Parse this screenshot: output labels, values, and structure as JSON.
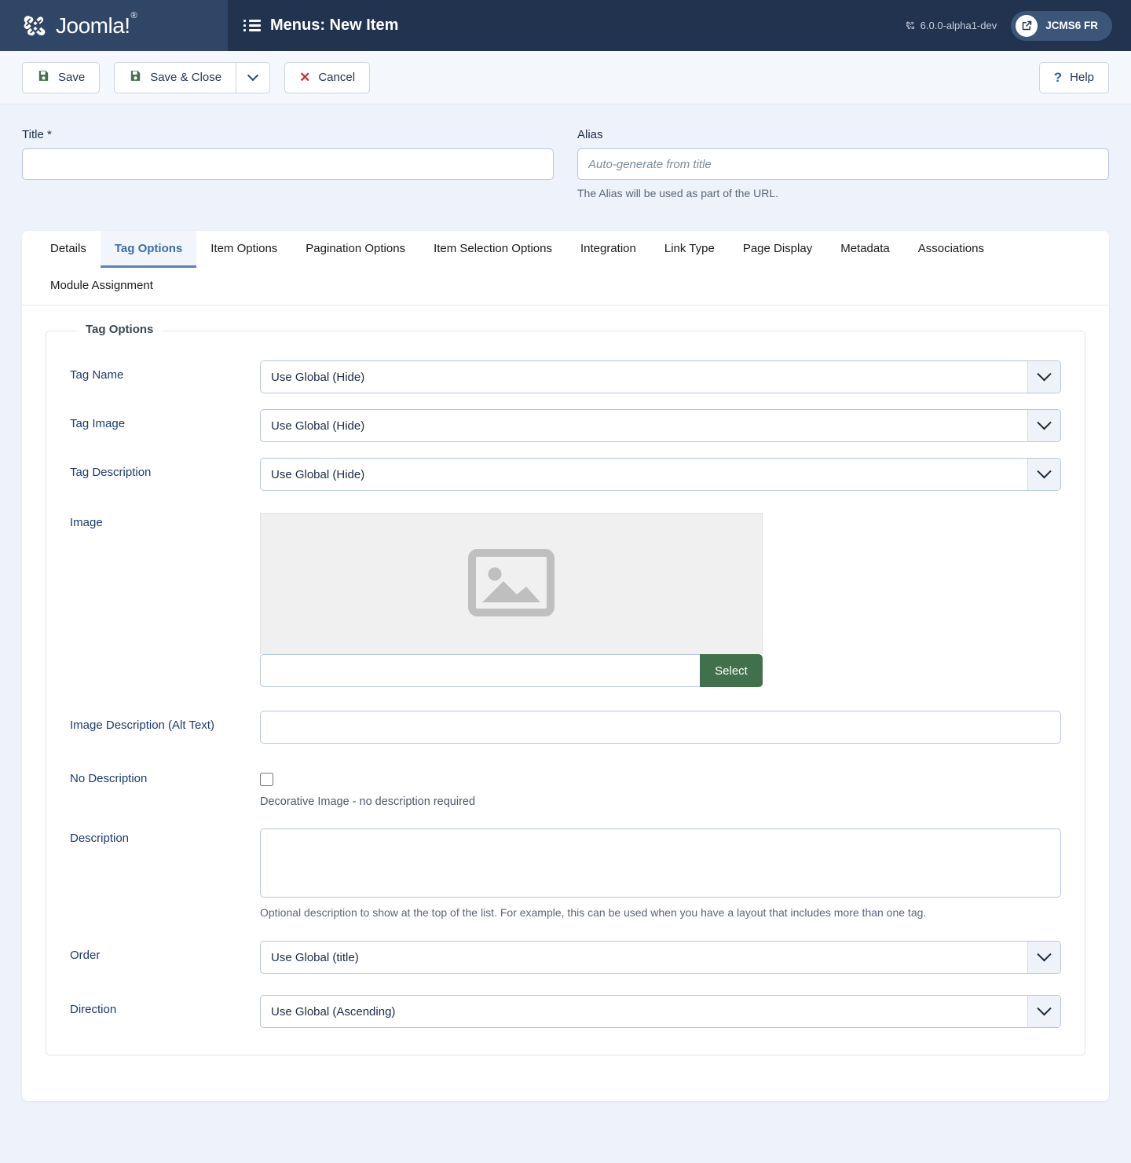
{
  "header": {
    "brand_name": "Joomla!",
    "brand_trademark": "®",
    "menu_icon": "list-icon",
    "page_title": "Menus: New Item",
    "version": "6.0.0-alpha1-dev",
    "version_icon": "joomla-mark-icon",
    "site_button_label": "JCMS6 FR",
    "site_button_icon": "external-link-icon"
  },
  "toolbar": {
    "save_label": "Save",
    "save_icon": "floppy-disk-icon",
    "save_close_label": "Save & Close",
    "save_close_icon": "floppy-disk-icon",
    "dropdown_icon": "chevron-down-icon",
    "cancel_label": "Cancel",
    "cancel_icon": "close-x-icon",
    "help_label": "Help",
    "help_icon": "question-mark-icon"
  },
  "form_top": {
    "title_label": "Title *",
    "title_value": "",
    "title_placeholder": "",
    "alias_label": "Alias",
    "alias_value": "",
    "alias_placeholder": "Auto-generate from title",
    "alias_helper": "The Alias will be used as part of the URL."
  },
  "tabs": [
    {
      "label": "Details",
      "active": false
    },
    {
      "label": "Tag Options",
      "active": true
    },
    {
      "label": "Item Options",
      "active": false
    },
    {
      "label": "Pagination Options",
      "active": false
    },
    {
      "label": "Item Selection Options",
      "active": false
    },
    {
      "label": "Integration",
      "active": false
    },
    {
      "label": "Link Type",
      "active": false
    },
    {
      "label": "Page Display",
      "active": false
    },
    {
      "label": "Metadata",
      "active": false
    },
    {
      "label": "Associations",
      "active": false
    },
    {
      "label": "Module Assignment",
      "active": false
    }
  ],
  "fieldset": {
    "legend": "Tag Options",
    "tag_name_label": "Tag Name",
    "tag_name_value": "Use Global (Hide)",
    "tag_image_label": "Tag Image",
    "tag_image_value": "Use Global (Hide)",
    "tag_description_label": "Tag Description",
    "tag_description_value": "Use Global (Hide)",
    "image_label": "Image",
    "image_placeholder_icon": "image-placeholder-icon",
    "image_path_value": "",
    "image_select_label": "Select",
    "image_alt_label": "Image Description (Alt Text)",
    "image_alt_value": "",
    "no_description_label": "No Description",
    "no_description_checked": false,
    "no_description_note": "Decorative Image - no description required",
    "description_label": "Description",
    "description_value": "",
    "description_note": "Optional description to show at the top of the list. For example, this can be used when you have a layout that includes more than one tag.",
    "order_label": "Order",
    "order_value": "Use Global (title)",
    "direction_label": "Direction",
    "direction_value": "Use Global (Ascending)"
  },
  "colors": {
    "brand_panel": "#2f4667",
    "header_bar": "#223350",
    "page_background": "#eef2fa",
    "accent_blue": "#3b6dae",
    "save_green": "#41714a",
    "cancel_red": "#c8322e",
    "help_blue": "#2a5fbf"
  }
}
